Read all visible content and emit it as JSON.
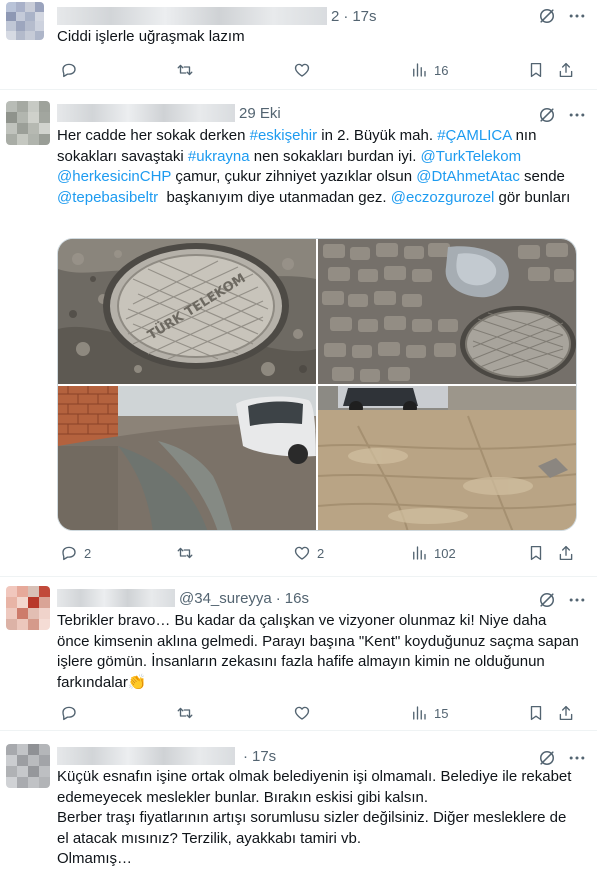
{
  "tweets": [
    {
      "time_prefix": "2",
      "time": "17s",
      "text": "Ciddi işlerle uğraşmak lazım",
      "replies": "",
      "retweets": "",
      "likes": "",
      "views": "16"
    },
    {
      "time": "29 Eki",
      "text_parts": {
        "t1": "Her cadde her sokak derken ",
        "l1": "#eskişehir",
        "t2": " in 2. Büyük mah. ",
        "l2": "#ÇAMLICA",
        "t3": " nın sokakları savaştaki ",
        "l3": "#ukrayna",
        "t4": " nen sokakları burdan iyi. ",
        "l4": "@TurkTelekom",
        "t5": " ",
        "l5": "@herkesicinCHP",
        "t6": " çamur, çukur zihniyet yazıklar olsun ",
        "l6": "@DtAhmetAtac",
        "t7": " sende ",
        "l7": "@tepebasibeltr",
        "t8": "  başkanıyım diye utanmadan gez. ",
        "l8": "@eczozgurozel",
        "t9": " gör bunları"
      },
      "photo_lid_text": "TÜRK TELEKOM",
      "replies": "2",
      "retweets": "",
      "likes": "2",
      "views": "102"
    },
    {
      "handle": "@34_sureyya",
      "time": "16s",
      "text": "Tebrikler bravo… Bu kadar da çalışkan ve vizyoner olunmaz ki! Niye daha önce kimsenin aklına gelmedi. Parayı başına \"Kent\" koyduğunuz saçma sapan işlere gömün. İnsanların zekasını fazla hafife almayın kimin ne olduğunun farkındalar",
      "emoji": "👏",
      "replies": "",
      "retweets": "",
      "likes": "",
      "views": "15"
    },
    {
      "time": "17s",
      "text": "Küçük esnafın işine ortak olmak belediyenin işi olmamalı. Belediye ile rekabet edemeyecek meslekler bunlar. Bırakın eskisi gibi kalsın.\nBerber traşı fiyatlarının artışı sorumlusu sizler değilsiniz. Diğer mesleklere de el atacak mısınız? Terzilik, ayakkabı tamiri vb.\nOlmamış…"
    }
  ],
  "colors": {
    "text": "#0f1419",
    "secondary": "#536471",
    "link": "#1d9bf0",
    "divider": "#eff3f4"
  },
  "icons": [
    "reply-icon",
    "retweet-icon",
    "like-icon",
    "views-icon",
    "bookmark-icon",
    "share-icon",
    "grok-icon",
    "more-icon"
  ]
}
